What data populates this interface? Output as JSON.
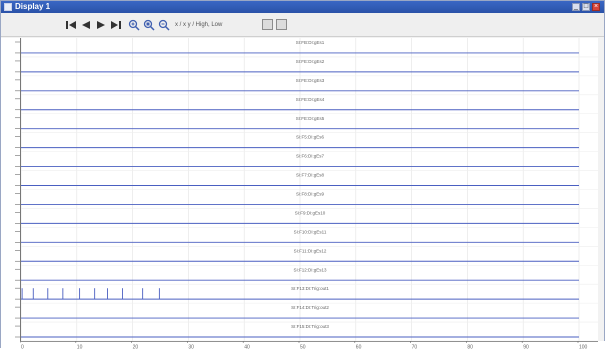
{
  "window": {
    "title": "Display 1",
    "controls": [
      "_",
      "□",
      "×"
    ]
  },
  "toolbar": {
    "axis_text": "x / x    y / High, Low",
    "buttons": [
      {
        "name": "first-page-button",
        "icon": "skip-back-icon"
      },
      {
        "name": "prev-page-button",
        "icon": "step-back-icon"
      },
      {
        "name": "next-page-button",
        "icon": "step-forward-icon"
      },
      {
        "name": "last-page-button",
        "icon": "skip-forward-icon"
      },
      {
        "name": "zoom-in-button",
        "icon": "zoom-in-icon"
      },
      {
        "name": "zoom-fit-button",
        "icon": "zoom-fit-icon"
      },
      {
        "name": "zoom-out-button",
        "icon": "zoom-out-icon"
      }
    ]
  },
  "channels": [
    {
      "label": "SI:FB:DI:gEs1",
      "signal": "low"
    },
    {
      "label": "SI:FE:DI:gEs2",
      "signal": "low"
    },
    {
      "label": "SI:FE:DI:gEs3",
      "signal": "low"
    },
    {
      "label": "SI:FE:DI:gEs4",
      "signal": "low"
    },
    {
      "label": "SI:FE:DI:gEs5",
      "signal": "low"
    },
    {
      "label": "SI:F5:DI:gEs6",
      "signal": "low"
    },
    {
      "label": "SI:F6:DI:gEs7",
      "signal": "low"
    },
    {
      "label": "SI:F7:DI:gEs8",
      "signal": "low"
    },
    {
      "label": "SI:F8:DI:gEs9",
      "signal": "low"
    },
    {
      "label": "SI:F9:DI:gEs10",
      "signal": "low"
    },
    {
      "label": "SI:F10:DI:gEs11",
      "signal": "low"
    },
    {
      "label": "SI:F11:DI:gEs12",
      "signal": "low"
    },
    {
      "label": "SI:F12:DI:gEs13",
      "signal": "low"
    },
    {
      "label": "SI:F13:DI:Trig:out1",
      "signal": "pulses"
    },
    {
      "label": "SI:F14:DI:Trig:out2",
      "signal": "low"
    },
    {
      "label": "SI:F15:DI:Trig:out3",
      "signal": "low"
    }
  ],
  "pulses_x": [
    0.2,
    2.2,
    4.8,
    7.5,
    10.5,
    13.2,
    15.5,
    18.2,
    21.8,
    24.8
  ],
  "xaxis": {
    "range": [
      0,
      100
    ],
    "ticks": [
      "0",
      "10",
      "20",
      "30",
      "40",
      "50",
      "60",
      "70",
      "80",
      "90",
      "100"
    ]
  },
  "colors": {
    "signal": "#4a5fc1",
    "grid": "#e3e3e3",
    "axis": "#6c6c6c",
    "label": "#666666"
  }
}
